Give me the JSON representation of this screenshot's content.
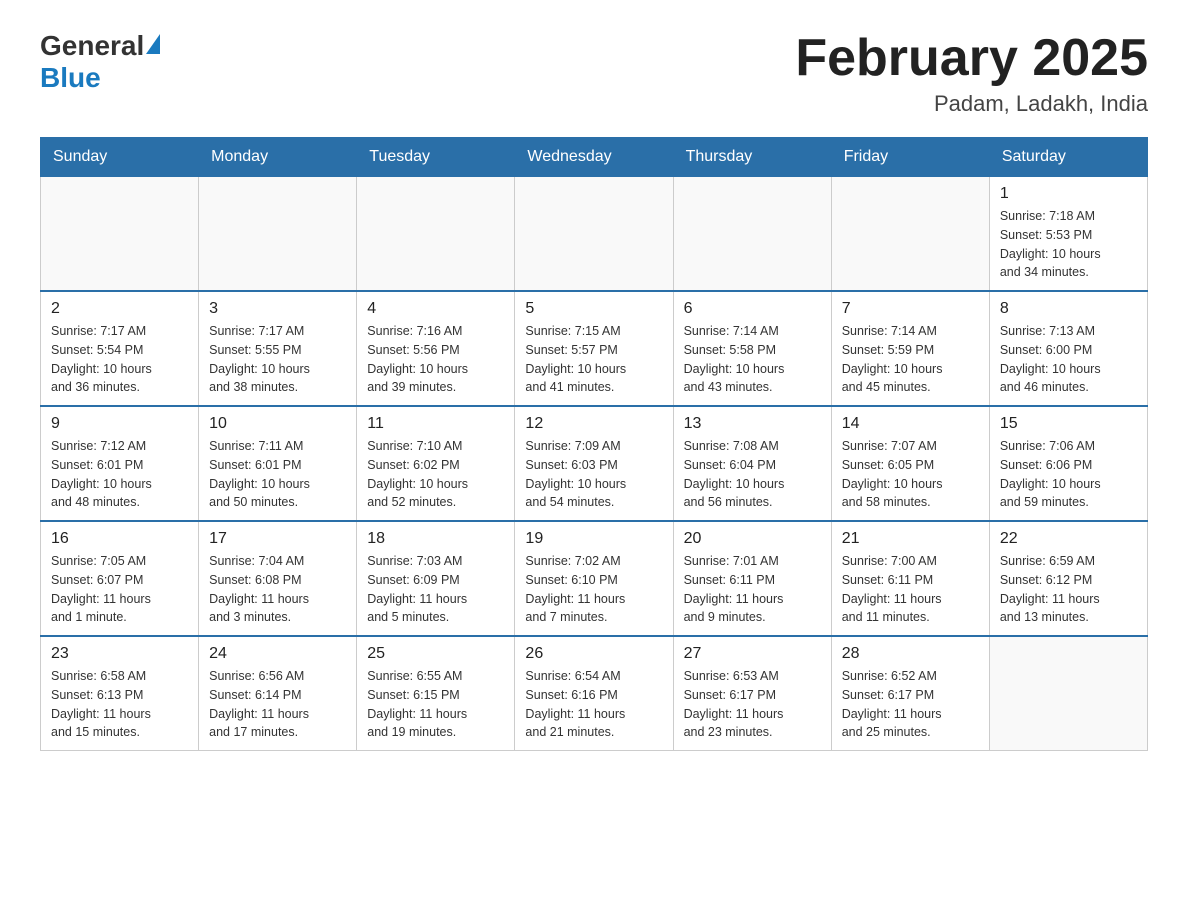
{
  "header": {
    "title": "February 2025",
    "subtitle": "Padam, Ladakh, India",
    "logo_general": "General",
    "logo_blue": "Blue"
  },
  "weekdays": [
    "Sunday",
    "Monday",
    "Tuesday",
    "Wednesday",
    "Thursday",
    "Friday",
    "Saturday"
  ],
  "weeks": [
    [
      {
        "day": "",
        "info": ""
      },
      {
        "day": "",
        "info": ""
      },
      {
        "day": "",
        "info": ""
      },
      {
        "day": "",
        "info": ""
      },
      {
        "day": "",
        "info": ""
      },
      {
        "day": "",
        "info": ""
      },
      {
        "day": "1",
        "info": "Sunrise: 7:18 AM\nSunset: 5:53 PM\nDaylight: 10 hours\nand 34 minutes."
      }
    ],
    [
      {
        "day": "2",
        "info": "Sunrise: 7:17 AM\nSunset: 5:54 PM\nDaylight: 10 hours\nand 36 minutes."
      },
      {
        "day": "3",
        "info": "Sunrise: 7:17 AM\nSunset: 5:55 PM\nDaylight: 10 hours\nand 38 minutes."
      },
      {
        "day": "4",
        "info": "Sunrise: 7:16 AM\nSunset: 5:56 PM\nDaylight: 10 hours\nand 39 minutes."
      },
      {
        "day": "5",
        "info": "Sunrise: 7:15 AM\nSunset: 5:57 PM\nDaylight: 10 hours\nand 41 minutes."
      },
      {
        "day": "6",
        "info": "Sunrise: 7:14 AM\nSunset: 5:58 PM\nDaylight: 10 hours\nand 43 minutes."
      },
      {
        "day": "7",
        "info": "Sunrise: 7:14 AM\nSunset: 5:59 PM\nDaylight: 10 hours\nand 45 minutes."
      },
      {
        "day": "8",
        "info": "Sunrise: 7:13 AM\nSunset: 6:00 PM\nDaylight: 10 hours\nand 46 minutes."
      }
    ],
    [
      {
        "day": "9",
        "info": "Sunrise: 7:12 AM\nSunset: 6:01 PM\nDaylight: 10 hours\nand 48 minutes."
      },
      {
        "day": "10",
        "info": "Sunrise: 7:11 AM\nSunset: 6:01 PM\nDaylight: 10 hours\nand 50 minutes."
      },
      {
        "day": "11",
        "info": "Sunrise: 7:10 AM\nSunset: 6:02 PM\nDaylight: 10 hours\nand 52 minutes."
      },
      {
        "day": "12",
        "info": "Sunrise: 7:09 AM\nSunset: 6:03 PM\nDaylight: 10 hours\nand 54 minutes."
      },
      {
        "day": "13",
        "info": "Sunrise: 7:08 AM\nSunset: 6:04 PM\nDaylight: 10 hours\nand 56 minutes."
      },
      {
        "day": "14",
        "info": "Sunrise: 7:07 AM\nSunset: 6:05 PM\nDaylight: 10 hours\nand 58 minutes."
      },
      {
        "day": "15",
        "info": "Sunrise: 7:06 AM\nSunset: 6:06 PM\nDaylight: 10 hours\nand 59 minutes."
      }
    ],
    [
      {
        "day": "16",
        "info": "Sunrise: 7:05 AM\nSunset: 6:07 PM\nDaylight: 11 hours\nand 1 minute."
      },
      {
        "day": "17",
        "info": "Sunrise: 7:04 AM\nSunset: 6:08 PM\nDaylight: 11 hours\nand 3 minutes."
      },
      {
        "day": "18",
        "info": "Sunrise: 7:03 AM\nSunset: 6:09 PM\nDaylight: 11 hours\nand 5 minutes."
      },
      {
        "day": "19",
        "info": "Sunrise: 7:02 AM\nSunset: 6:10 PM\nDaylight: 11 hours\nand 7 minutes."
      },
      {
        "day": "20",
        "info": "Sunrise: 7:01 AM\nSunset: 6:11 PM\nDaylight: 11 hours\nand 9 minutes."
      },
      {
        "day": "21",
        "info": "Sunrise: 7:00 AM\nSunset: 6:11 PM\nDaylight: 11 hours\nand 11 minutes."
      },
      {
        "day": "22",
        "info": "Sunrise: 6:59 AM\nSunset: 6:12 PM\nDaylight: 11 hours\nand 13 minutes."
      }
    ],
    [
      {
        "day": "23",
        "info": "Sunrise: 6:58 AM\nSunset: 6:13 PM\nDaylight: 11 hours\nand 15 minutes."
      },
      {
        "day": "24",
        "info": "Sunrise: 6:56 AM\nSunset: 6:14 PM\nDaylight: 11 hours\nand 17 minutes."
      },
      {
        "day": "25",
        "info": "Sunrise: 6:55 AM\nSunset: 6:15 PM\nDaylight: 11 hours\nand 19 minutes."
      },
      {
        "day": "26",
        "info": "Sunrise: 6:54 AM\nSunset: 6:16 PM\nDaylight: 11 hours\nand 21 minutes."
      },
      {
        "day": "27",
        "info": "Sunrise: 6:53 AM\nSunset: 6:17 PM\nDaylight: 11 hours\nand 23 minutes."
      },
      {
        "day": "28",
        "info": "Sunrise: 6:52 AM\nSunset: 6:17 PM\nDaylight: 11 hours\nand 25 minutes."
      },
      {
        "day": "",
        "info": ""
      }
    ]
  ]
}
